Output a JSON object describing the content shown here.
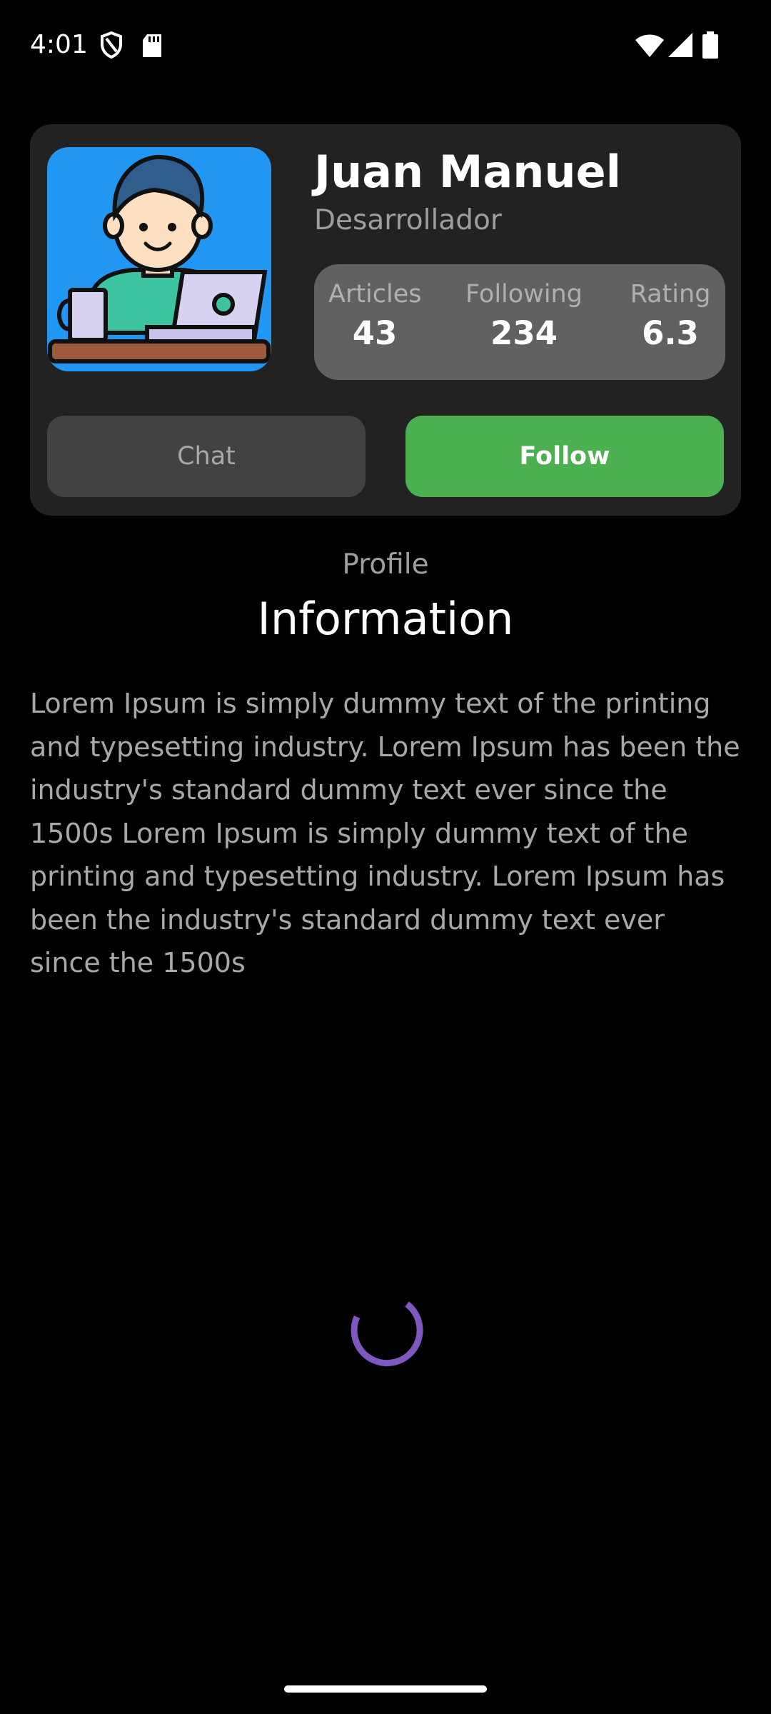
{
  "status_bar": {
    "time": "4:01",
    "icons": [
      "shield-icon",
      "sd-card-icon",
      "wifi-icon",
      "signal-icon",
      "battery-icon"
    ]
  },
  "profile": {
    "name": "Juan Manuel",
    "role": "Desarrollador",
    "avatar_icon": "developer-avatar-icon",
    "stats": [
      {
        "label": "Articles",
        "value": "43"
      },
      {
        "label": "Following",
        "value": "234"
      },
      {
        "label": "Rating",
        "value": "6.3"
      }
    ],
    "buttons": {
      "chat_label": "Chat",
      "follow_label": "Follow"
    }
  },
  "section": {
    "subtitle": "Profile",
    "title": "Information",
    "body": "Lorem Ipsum is simply dummy text of the printing and typesetting industry. Lorem Ipsum has been the industry's standard dummy text ever since the 1500s Lorem Ipsum is simply dummy text of the printing and typesetting industry. Lorem Ipsum has been the industry's standard dummy text ever since the 1500s"
  },
  "colors": {
    "background": "#000000",
    "card": "#222222",
    "stats_box": "#616161",
    "chat_button": "#424242",
    "follow_button": "#4CAF50",
    "avatar_bg": "#2196F3",
    "spinner": "#7E57C2"
  }
}
